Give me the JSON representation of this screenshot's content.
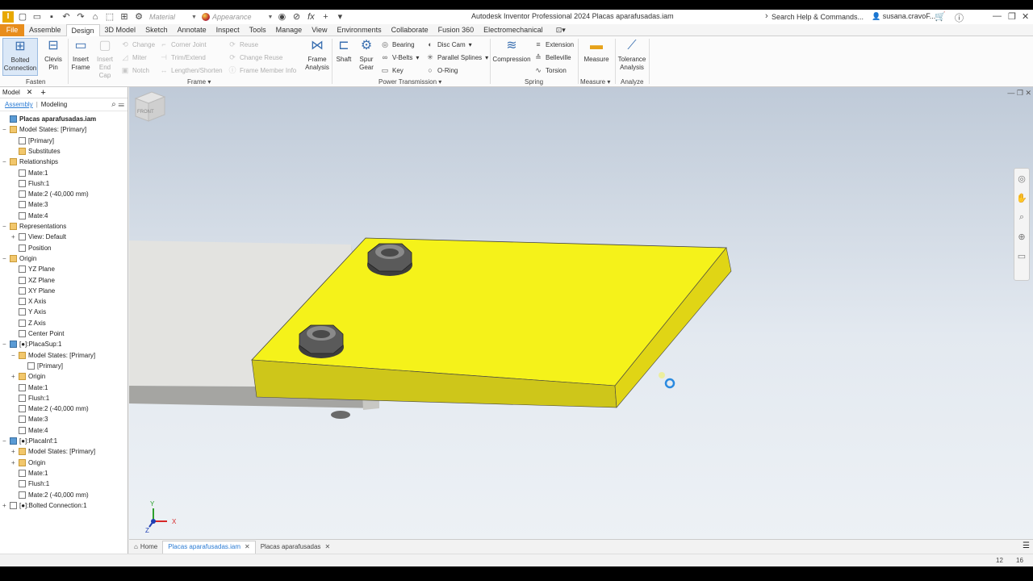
{
  "app": {
    "title": "Autodesk Inventor Professional 2024   Placas aparafusadas.iam",
    "logo_letter": "I",
    "help_search_placeholder": "Search Help & Commands...",
    "user_name": "susana.cravoF..."
  },
  "qat": {
    "material_label": "Material",
    "appearance_label": "Appearance"
  },
  "ribbon_tabs": [
    "File",
    "Assemble",
    "Design",
    "3D Model",
    "Sketch",
    "Annotate",
    "Inspect",
    "Tools",
    "Manage",
    "View",
    "Environments",
    "Collaborate",
    "Fusion 360",
    "Electromechanical"
  ],
  "ribbon": {
    "fasten": {
      "bolted_connection": "Bolted Connection",
      "clevis_pin": "Clevis Pin",
      "group": "Fasten"
    },
    "frame": {
      "insert_frame": "Insert Frame",
      "insert_end_cap": "Insert End Cap",
      "change": "Change",
      "miter": "Miter",
      "notch": "Notch",
      "corner_joint": "Corner Joint",
      "trim_extend": "Trim/Extend",
      "lengthen_shorten": "Lengthen/Shorten",
      "reuse": "Reuse",
      "change_reuse": "Change Reuse",
      "frame_member_info": "Frame Member Info",
      "frame_analysis": "Frame Analysis",
      "group": "Frame"
    },
    "power": {
      "shaft": "Shaft",
      "spur_gear": "Spur Gear",
      "bearing": "Bearing",
      "v_belts": "V-Belts",
      "key": "Key",
      "disc_cam": "Disc Cam",
      "parallel_splines": "Parallel Splines",
      "o_ring": "O-Ring",
      "group": "Power Transmission"
    },
    "spring": {
      "compression": "Compression",
      "extension": "Extension",
      "belleville": "Belleville",
      "torsion": "Torsion",
      "group": "Spring"
    },
    "measure": {
      "measure": "Measure",
      "group": "Measure"
    },
    "analyze": {
      "tolerance_analysis": "Tolerance Analysis",
      "group": "Analyze"
    }
  },
  "browser": {
    "tab_label": "Model",
    "mode_assembly": "Assembly",
    "mode_modeling": "Modeling",
    "tree": [
      {
        "label": "Placas aparafusadas.iam",
        "level": 0,
        "icon": "assembly-icon",
        "exp": "",
        "bold": true
      },
      {
        "label": "Model States: [Primary]",
        "level": 0,
        "icon": "folder-icon",
        "exp": "−"
      },
      {
        "label": "[Primary]",
        "level": 1,
        "icon": "model-state-icon",
        "exp": ""
      },
      {
        "label": "Substitutes",
        "level": 1,
        "icon": "folder-icon",
        "exp": ""
      },
      {
        "label": "Relationships",
        "level": 0,
        "icon": "folder-icon",
        "exp": "−"
      },
      {
        "label": "Mate:1",
        "level": 1,
        "icon": "constraint-icon",
        "exp": ""
      },
      {
        "label": "Flush:1",
        "level": 1,
        "icon": "constraint-icon",
        "exp": ""
      },
      {
        "label": "Mate:2 (-40,000 mm)",
        "level": 1,
        "icon": "constraint-icon",
        "exp": ""
      },
      {
        "label": "Mate:3",
        "level": 1,
        "icon": "constraint-icon",
        "exp": ""
      },
      {
        "label": "Mate:4",
        "level": 1,
        "icon": "constraint-icon",
        "exp": ""
      },
      {
        "label": "Representations",
        "level": 0,
        "icon": "folder-icon",
        "exp": "−"
      },
      {
        "label": "View: Default",
        "level": 1,
        "icon": "view-icon",
        "exp": "+"
      },
      {
        "label": "Position",
        "level": 1,
        "icon": "position-icon",
        "exp": ""
      },
      {
        "label": "Origin",
        "level": 0,
        "icon": "folder-icon",
        "exp": "−"
      },
      {
        "label": "YZ Plane",
        "level": 1,
        "icon": "plane-icon",
        "exp": ""
      },
      {
        "label": "XZ Plane",
        "level": 1,
        "icon": "plane-icon",
        "exp": ""
      },
      {
        "label": "XY Plane",
        "level": 1,
        "icon": "plane-icon",
        "exp": ""
      },
      {
        "label": "X Axis",
        "level": 1,
        "icon": "axis-icon",
        "exp": ""
      },
      {
        "label": "Y Axis",
        "level": 1,
        "icon": "axis-icon",
        "exp": ""
      },
      {
        "label": "Z Axis",
        "level": 1,
        "icon": "axis-icon",
        "exp": ""
      },
      {
        "label": "Center Point",
        "level": 1,
        "icon": "point-icon",
        "exp": ""
      },
      {
        "label": "[●]:PlacaSup:1",
        "level": 0,
        "icon": "part-icon",
        "exp": "−"
      },
      {
        "label": "Model States: [Primary]",
        "level": 1,
        "icon": "folder-icon",
        "exp": "−"
      },
      {
        "label": "[Primary]",
        "level": 2,
        "icon": "model-state-icon",
        "exp": ""
      },
      {
        "label": "Origin",
        "level": 1,
        "icon": "folder-icon",
        "exp": "+"
      },
      {
        "label": "Mate:1",
        "level": 1,
        "icon": "constraint-icon",
        "exp": ""
      },
      {
        "label": "Flush:1",
        "level": 1,
        "icon": "constraint-icon",
        "exp": ""
      },
      {
        "label": "Mate:2 (-40,000 mm)",
        "level": 1,
        "icon": "constraint-icon",
        "exp": ""
      },
      {
        "label": "Mate:3",
        "level": 1,
        "icon": "constraint-icon",
        "exp": ""
      },
      {
        "label": "Mate:4",
        "level": 1,
        "icon": "constraint-icon",
        "exp": ""
      },
      {
        "label": "[●]:PlacaInf:1",
        "level": 0,
        "icon": "part-icon",
        "exp": "−"
      },
      {
        "label": "Model States: [Primary]",
        "level": 1,
        "icon": "folder-icon",
        "exp": "+"
      },
      {
        "label": "Origin",
        "level": 1,
        "icon": "folder-icon",
        "exp": "+"
      },
      {
        "label": "Mate:1",
        "level": 1,
        "icon": "constraint-icon",
        "exp": ""
      },
      {
        "label": "Flush:1",
        "level": 1,
        "icon": "constraint-icon",
        "exp": ""
      },
      {
        "label": "Mate:2 (-40,000 mm)",
        "level": 1,
        "icon": "constraint-icon",
        "exp": ""
      },
      {
        "label": "[●]:Bolted Connection:1",
        "level": 0,
        "icon": "bolted-connection-icon",
        "exp": "+"
      }
    ]
  },
  "viewport": {
    "viewcube_label": "FRONT",
    "axis_x": "X",
    "axis_y": "Y",
    "axis_z": "Z",
    "plate_top_color": "#f5f21a",
    "plate_bottom_color": "#e3e3e0"
  },
  "doc_tabs": {
    "home": "Home",
    "active": "Placas aparafusadas.iam",
    "second": "Placas aparafusadas"
  },
  "status": {
    "left_num": "12",
    "right_num": "16"
  }
}
